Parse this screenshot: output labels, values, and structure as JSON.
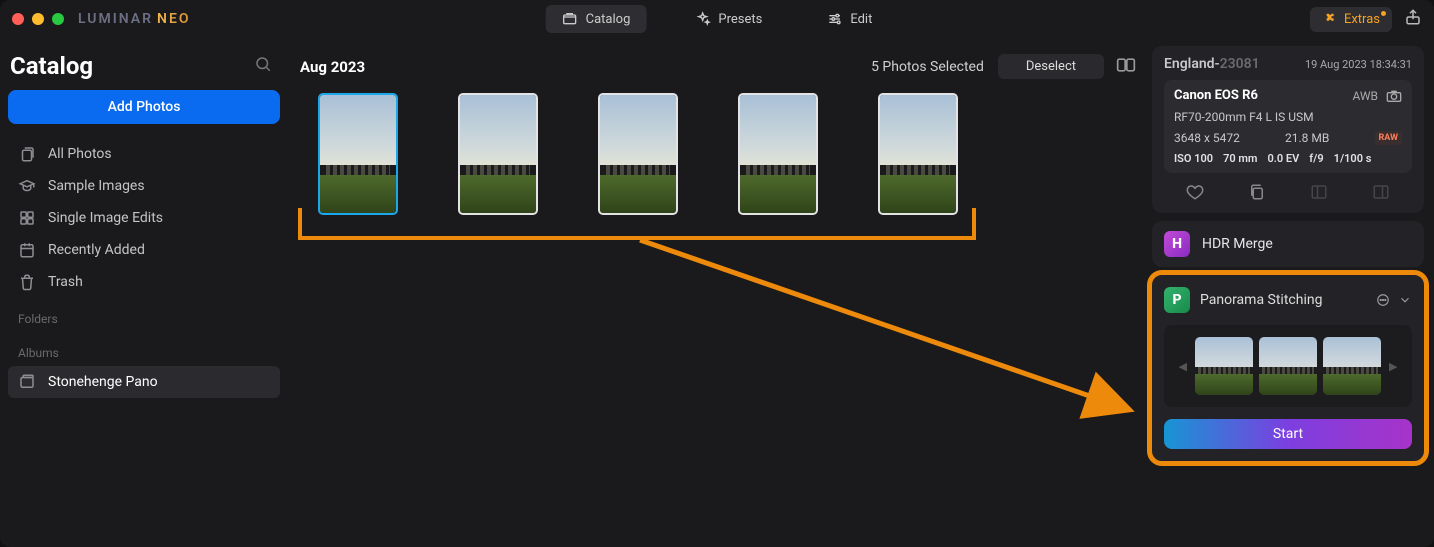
{
  "app": {
    "name_a": "LUMINAR",
    "name_b": "NEO"
  },
  "tabs": {
    "catalog": "Catalog",
    "presets": "Presets",
    "edit": "Edit"
  },
  "extras": {
    "label": "Extras"
  },
  "sidebar": {
    "title": "Catalog",
    "add_button": "Add Photos",
    "items": {
      "all": "All Photos",
      "sample": "Sample Images",
      "single": "Single Image Edits",
      "recent": "Recently Added",
      "trash": "Trash"
    },
    "sections": {
      "folders": "Folders",
      "albums": "Albums"
    },
    "album_sel": "Stonehenge Pano"
  },
  "main": {
    "title": "Aug 2023",
    "selected_text": "5 Photos Selected",
    "deselect": "Deselect"
  },
  "info": {
    "name_main": "England-",
    "name_trunc": "23081",
    "date": "19 Aug 2023 18:34:31",
    "camera": "Canon EOS R6",
    "awb": "AWB",
    "lens": "RF70-200mm F4 L IS USM",
    "dims": "3648 x 5472",
    "size": "21.8 MB",
    "raw": "RAW",
    "iso": "ISO 100",
    "focal": "70 mm",
    "ev": "0.0 EV",
    "aperture": "f/9",
    "shutter": "1/100 s"
  },
  "hdr": {
    "label": "HDR Merge"
  },
  "pano": {
    "label": "Panorama Stitching",
    "start": "Start"
  }
}
